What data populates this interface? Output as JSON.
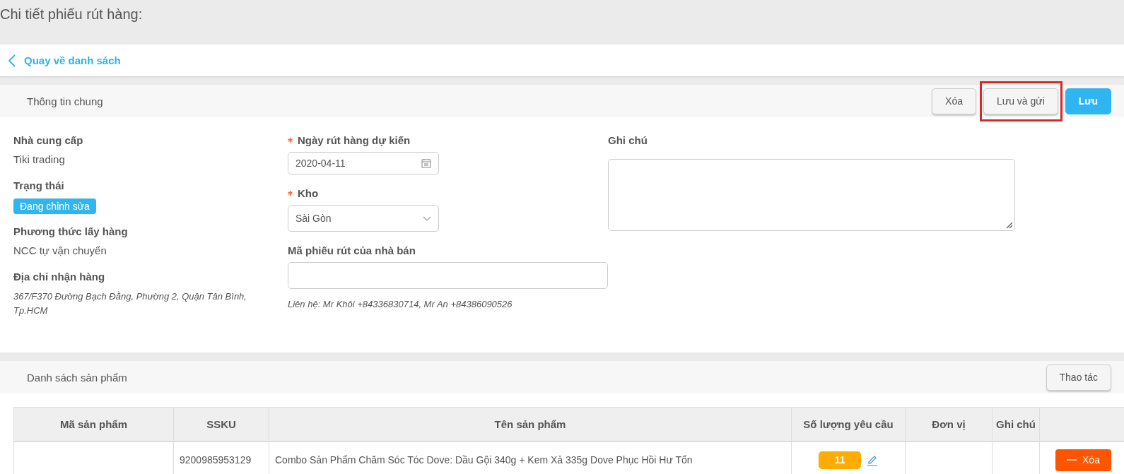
{
  "page_title": "Chi tiết phiếu rút hàng:",
  "back_link": {
    "label": "Quay về danh sách"
  },
  "general_section": {
    "title": "Thông tin chung",
    "buttons": [
      {
        "label": "Xóa",
        "kind": "default",
        "highlighted": false
      },
      {
        "label": "Lưu và gửi",
        "kind": "default",
        "highlighted": true
      },
      {
        "label": "Lưu",
        "kind": "primary",
        "highlighted": false
      }
    ]
  },
  "info": [
    {
      "kind": "text",
      "label": "Nhà cung cấp",
      "value": "Tiki trading"
    },
    {
      "kind": "badge",
      "label": "Trạng thái",
      "value": "Đang chỉnh sửa"
    },
    {
      "kind": "text",
      "label": "Phương thức lấy hàng",
      "value": "NCC tự vận chuyển"
    },
    {
      "kind": "note",
      "label": "Địa chỉ nhận hàng",
      "value": "367/F370 Đường Bạch Đằng, Phường 2, Quận Tân Bình, Tp.HCM"
    }
  ],
  "fields": [
    {
      "kind": "date",
      "label": "Ngày rút hàng dự kiến",
      "required": true,
      "value": "2020-04-11"
    },
    {
      "kind": "select",
      "label": "Kho",
      "required": true,
      "value": "Sài Gòn"
    },
    {
      "kind": "text",
      "label": "Mã phiếu rút của nhà bán",
      "required": false,
      "hint": "Liên hệ: Mr Khôi +84336830714, Mr An +84386090526"
    }
  ],
  "note_field": {
    "label": "Ghi chú"
  },
  "products": {
    "title": "Danh sách sản phẩm",
    "action_button": "Thao tác",
    "columns": [
      "Mã sản phẩm",
      "SSKU",
      "Tên sản phẩm",
      "Số lượng yêu cầu",
      "Đơn vị",
      "Ghi chú"
    ],
    "rows": [
      {
        "sku": "9200985953129",
        "name": "Combo Sản Phẩm Chăm Sóc Tóc Dove: Dầu Gội 340g + Kem Xả 335g Dove Phục Hồi Hư Tổn",
        "quantity": "11",
        "delete_label": "Xóa"
      }
    ]
  }
}
